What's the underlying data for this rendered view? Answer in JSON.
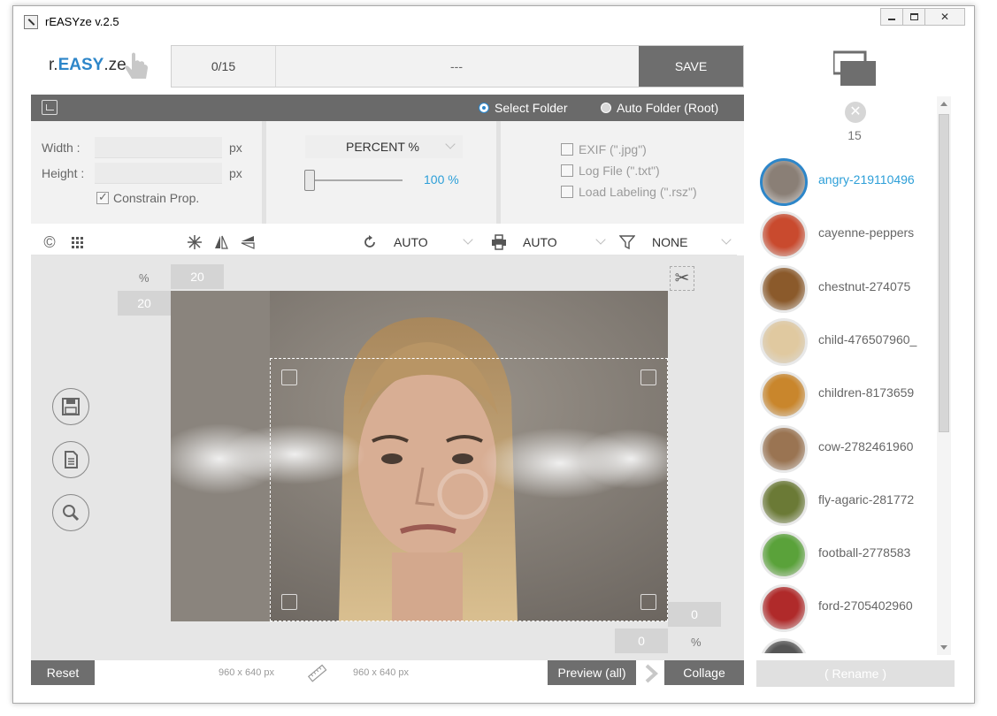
{
  "window": {
    "title": "rEASYze v.2.5",
    "minimize_glyph": "",
    "close_glyph": "✕"
  },
  "logo": {
    "prefix": "r.",
    "main": "EASY",
    "suffix": ".ze"
  },
  "progress": {
    "count": "0/15",
    "status": "---",
    "save_label": "SAVE"
  },
  "folder_bar": {
    "options": [
      {
        "label": "Select Folder",
        "selected": true
      },
      {
        "label": "Auto Folder (Root)",
        "selected": false
      }
    ]
  },
  "size_panel": {
    "width_label": "Width :",
    "height_label": "Height :",
    "width_value": "",
    "height_value": "",
    "unit": "px",
    "constrain_label": "Constrain Prop.",
    "constrain_checked": true
  },
  "scale_panel": {
    "mode": "PERCENT %",
    "percent_value": "100 %",
    "percent": 0.0
  },
  "options_panel": {
    "exif": "EXIF (\".jpg\")",
    "log": "Log File (\".txt\")",
    "labeling": "Load Labeling (\".rsz\")"
  },
  "toolbar": {
    "copyright_glyph": "©",
    "rotate_value": "AUTO",
    "print_value": "AUTO",
    "filter_value": "NONE"
  },
  "canvas": {
    "top_percent_label": "%",
    "top_value": "20",
    "left_value": "20",
    "bottom_right_value": "0",
    "bottom_value": "0",
    "bottom_percent_label": "%"
  },
  "bottom": {
    "reset_label": "Reset",
    "source_size": "960 x 640 px",
    "target_size": "960 x 640 px",
    "preview_label": "Preview (all)",
    "collage_label": "Collage",
    "rename_label": "( Rename )"
  },
  "file_list": {
    "count": "15",
    "items": [
      {
        "name": "angry-219110496",
        "active": true,
        "color": "#8a7f76"
      },
      {
        "name": "cayenne-peppers",
        "active": false,
        "color": "#c94a2e"
      },
      {
        "name": "chestnut-274075",
        "active": false,
        "color": "#8b5a2b"
      },
      {
        "name": "child-476507960_",
        "active": false,
        "color": "#e0c9a0"
      },
      {
        "name": "children-8173659",
        "active": false,
        "color": "#c9862c"
      },
      {
        "name": "cow-2782461960",
        "active": false,
        "color": "#9a7452"
      },
      {
        "name": "fly-agaric-281772",
        "active": false,
        "color": "#6b7a36"
      },
      {
        "name": "football-2778583",
        "active": false,
        "color": "#5aa23a"
      },
      {
        "name": "ford-2705402960",
        "active": false,
        "color": "#b02a2a"
      },
      {
        "name": "",
        "active": false,
        "color": "#555555"
      }
    ]
  },
  "colors": {
    "accent": "#2d86c9",
    "dark_button": "#6e6e6e",
    "panel": "#f2f2f2"
  }
}
